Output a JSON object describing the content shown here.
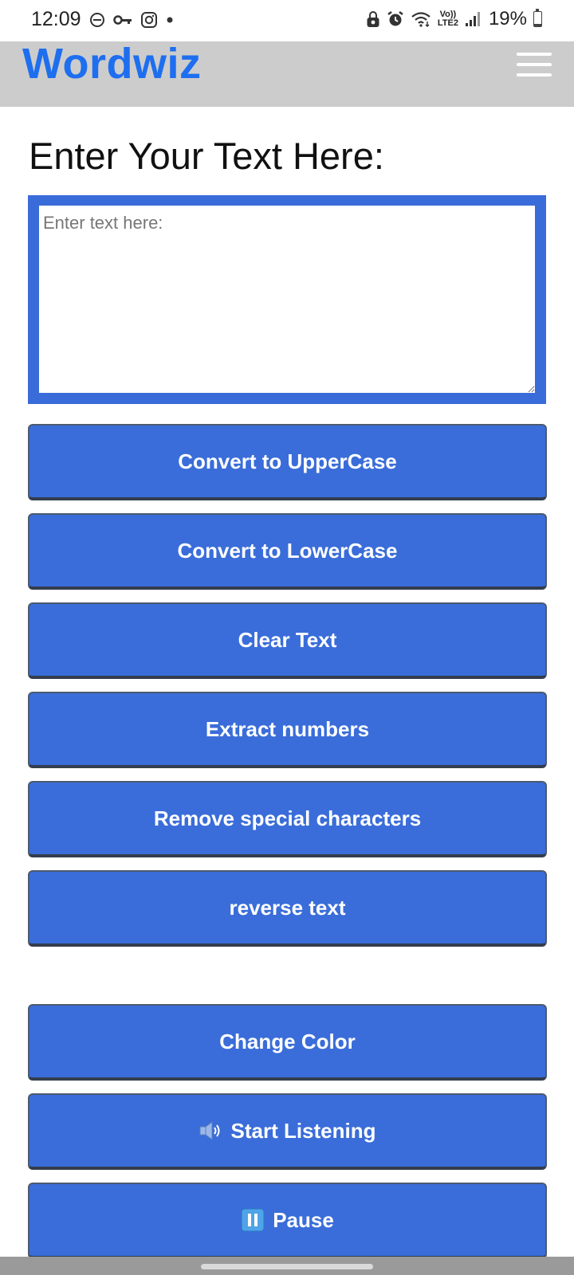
{
  "status_bar": {
    "time": "12:09",
    "left_icons": [
      "do-not-disturb-icon",
      "vpn-key-icon",
      "instagram-icon",
      "notification-dot-icon"
    ],
    "right_icons": [
      "lock-bell-icon",
      "alarm-icon",
      "wifi-icon",
      "volte-icon",
      "signal-icon"
    ],
    "network_label_top": "Vo))",
    "network_label_bottom": "LTE2",
    "battery_percent": "19%",
    "battery_level": 0.19
  },
  "header": {
    "brand": "Wordwiz",
    "brand_color": "#1e6ef0",
    "background": "#cccccc",
    "menu_icon": "hamburger-menu-icon"
  },
  "main": {
    "heading": "Enter Your Text Here:",
    "textarea": {
      "placeholder": "Enter text here:",
      "value": ""
    },
    "accent_color": "#3a6dd9",
    "buttons": [
      {
        "label": "Convert to UpperCase"
      },
      {
        "label": "Convert to LowerCase"
      },
      {
        "label": "Clear Text"
      },
      {
        "label": "Extract numbers"
      },
      {
        "label": "Remove special characters"
      },
      {
        "label": "reverse text"
      },
      {
        "label": "Change Color"
      },
      {
        "label": "Start Listening",
        "icon": "speaker-icon"
      },
      {
        "label": "Pause",
        "icon": "pause-icon"
      }
    ]
  }
}
